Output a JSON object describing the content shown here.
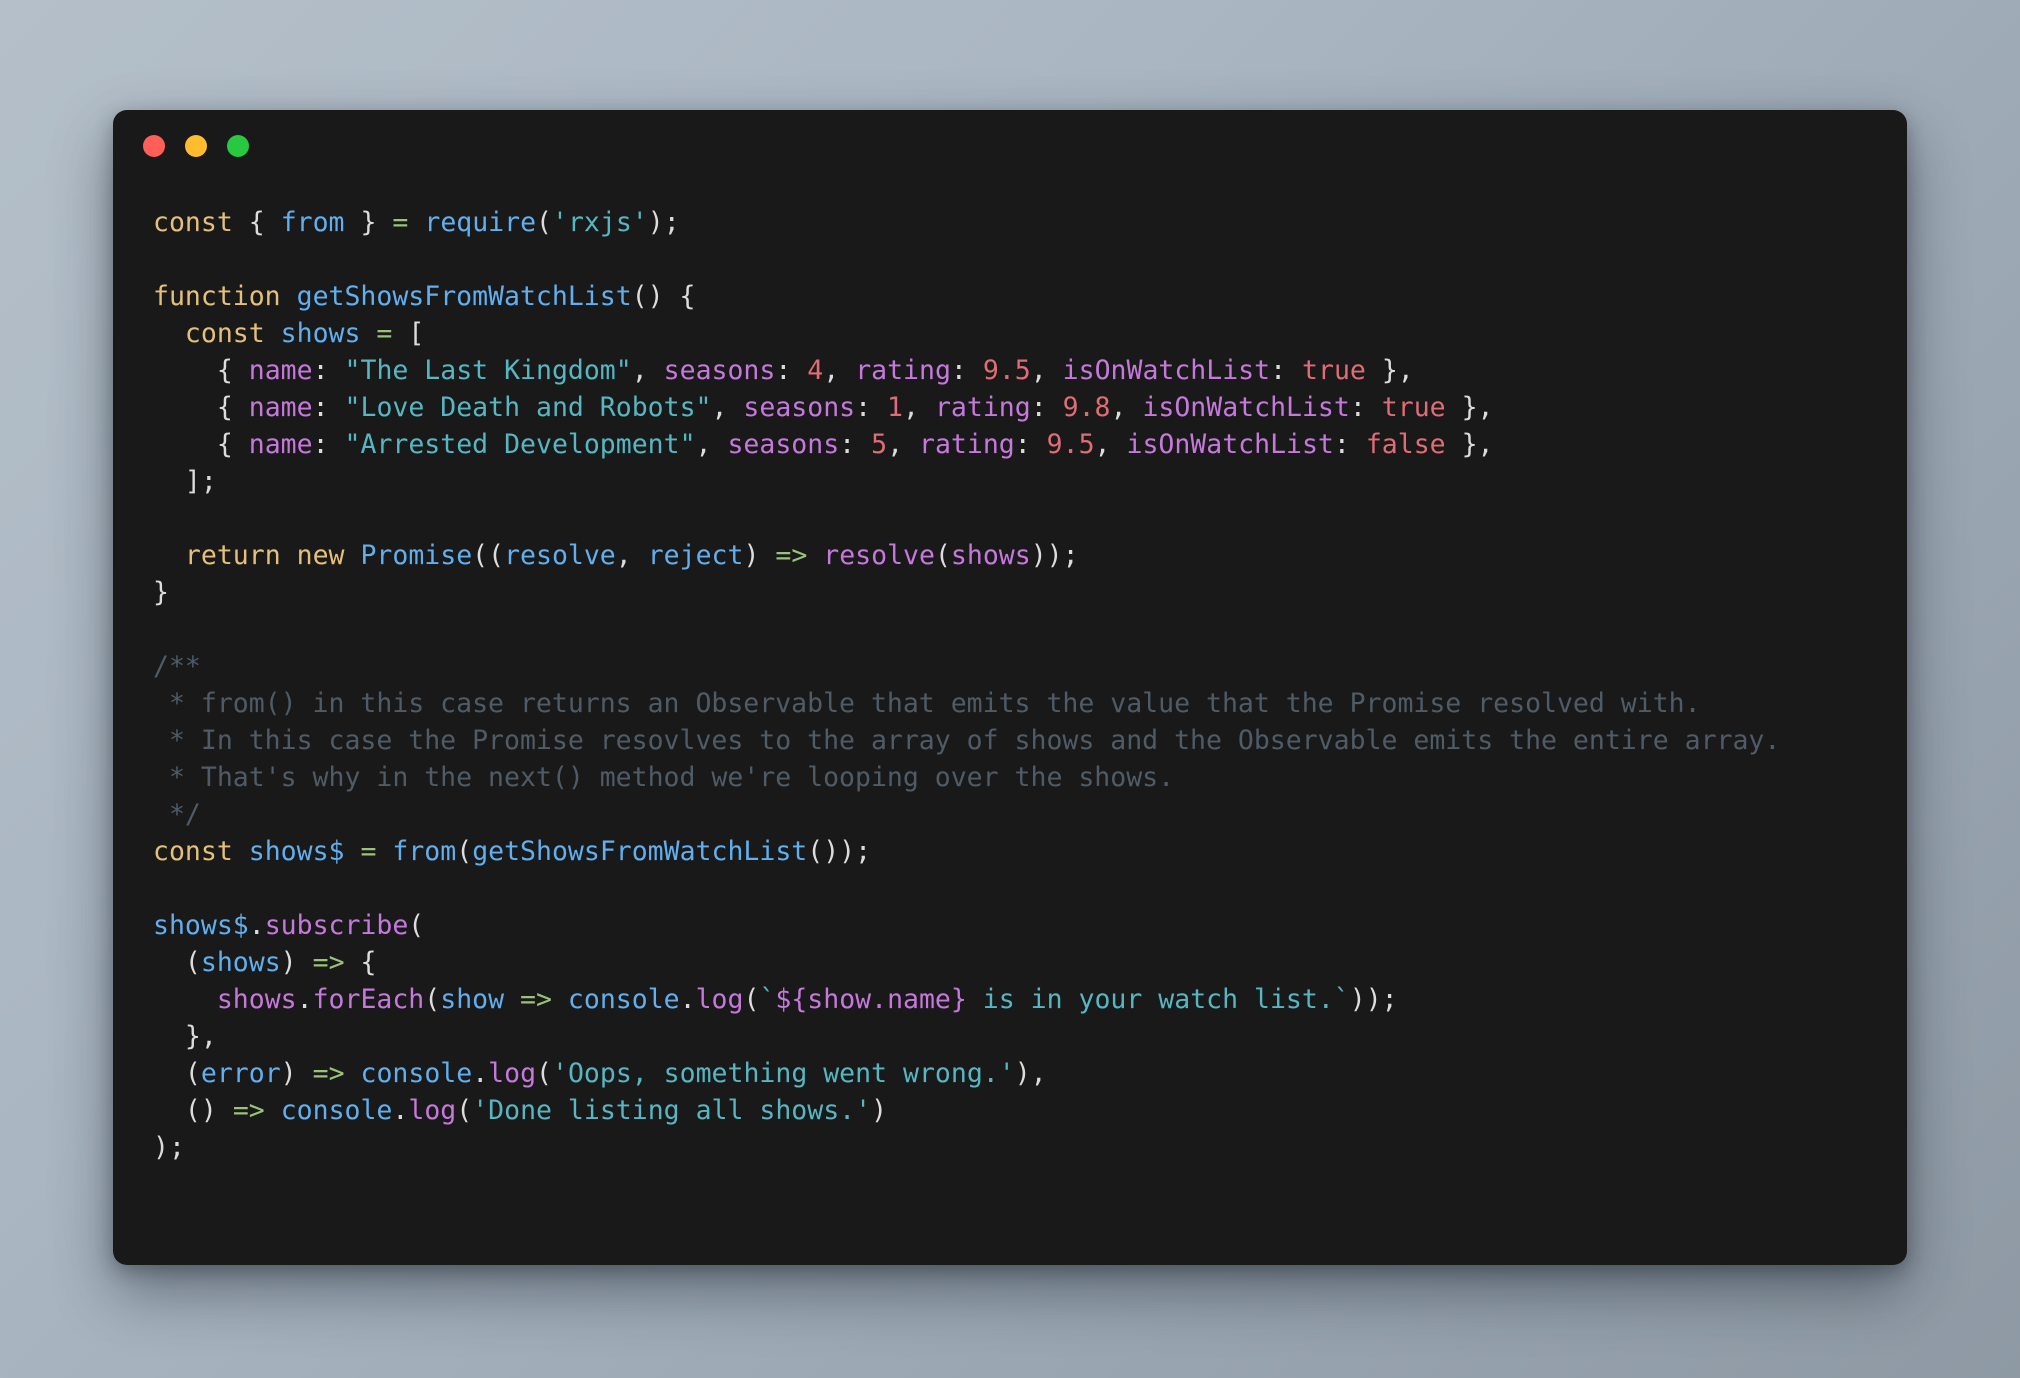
{
  "window": {
    "background_color": "#191919",
    "traffic_lights": [
      {
        "name": "close",
        "color": "#ff5f57"
      },
      {
        "name": "minimize",
        "color": "#febc2e"
      },
      {
        "name": "maximize",
        "color": "#28c840"
      }
    ]
  },
  "theme": {
    "keyword": "#e5c07b",
    "function": "#61afef",
    "string": "#56b6c2",
    "number": "#e06c75",
    "property": "#c678dd",
    "operator": "#98c379",
    "punctuation": "#dcdcdc",
    "comment": "#4f5b66",
    "desktop_gradient_from": "#b4bfc9",
    "desktop_gradient_to": "#8e99a4"
  },
  "code": {
    "language": "javascript",
    "line01": "const { from } = require('rxjs');",
    "line02": "",
    "line03": "function getShowsFromWatchList() {",
    "line04": "  const shows = [",
    "line05": "    { name: \"The Last Kingdom\", seasons: 4, rating: 9.5, isOnWatchList: true },",
    "line06": "    { name: \"Love Death and Robots\", seasons: 1, rating: 9.8, isOnWatchList: true },",
    "line07": "    { name: \"Arrested Development\", seasons: 5, rating: 9.5, isOnWatchList: false },",
    "line08": "  ];",
    "line09": "",
    "line10": "  return new Promise((resolve, reject) => resolve(shows));",
    "line11": "}",
    "line12": "",
    "line13": "/**",
    "line14": " * from() in this case returns an Observable that emits the value that the Promise resolved with.",
    "line15": " * In this case the Promise resovlves to the array of shows and the Observable emits the entire array.",
    "line16": " * That's why in the next() method we're looping over the shows.",
    "line17": " */",
    "line18": "const shows$ = from(getShowsFromWatchList());",
    "line19": "",
    "line20": "shows$.subscribe(",
    "line21": "  (shows) => {",
    "line22": "    shows.forEach(show => console.log(`${show.name} is in your watch list.`));",
    "line23": "  },",
    "line24": "  (error) => console.log('Oops, something went wrong.'),",
    "line25": "  () => console.log('Done listing all shows.')",
    "line26": ");"
  },
  "shows_data": [
    {
      "name": "The Last Kingdom",
      "seasons": 4,
      "rating": 9.5,
      "isOnWatchList": true
    },
    {
      "name": "Love Death and Robots",
      "seasons": 1,
      "rating": 9.8,
      "isOnWatchList": true
    },
    {
      "name": "Arrested Development",
      "seasons": 5,
      "rating": 9.5,
      "isOnWatchList": false
    }
  ],
  "strings": {
    "module": "rxjs",
    "error_message": "Oops, something went wrong.",
    "complete_message": "Done listing all shows.",
    "template_message": "${show.name} is in your watch list."
  }
}
